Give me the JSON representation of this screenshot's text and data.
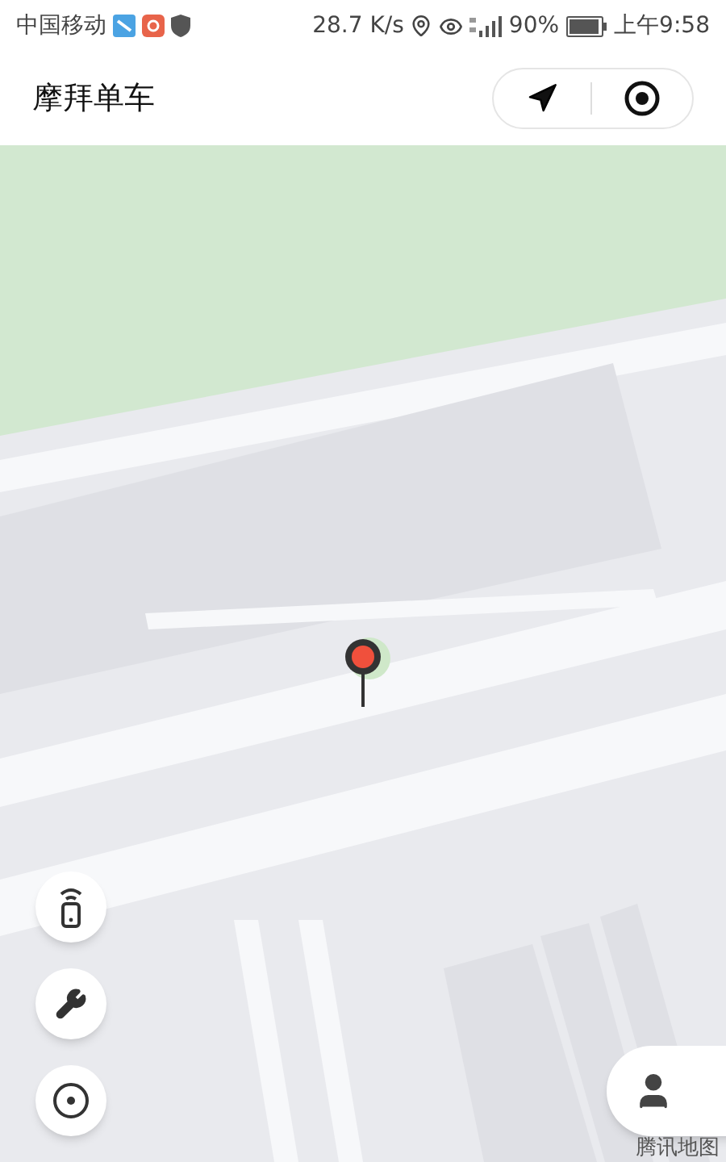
{
  "status_bar": {
    "carrier": "中国移动",
    "speed": "28.7 K/s",
    "battery": "90%",
    "time": "上午9:58"
  },
  "header": {
    "title": "摩拜单车"
  },
  "map": {
    "kind": "picture",
    "logo": "腾讯地图"
  }
}
